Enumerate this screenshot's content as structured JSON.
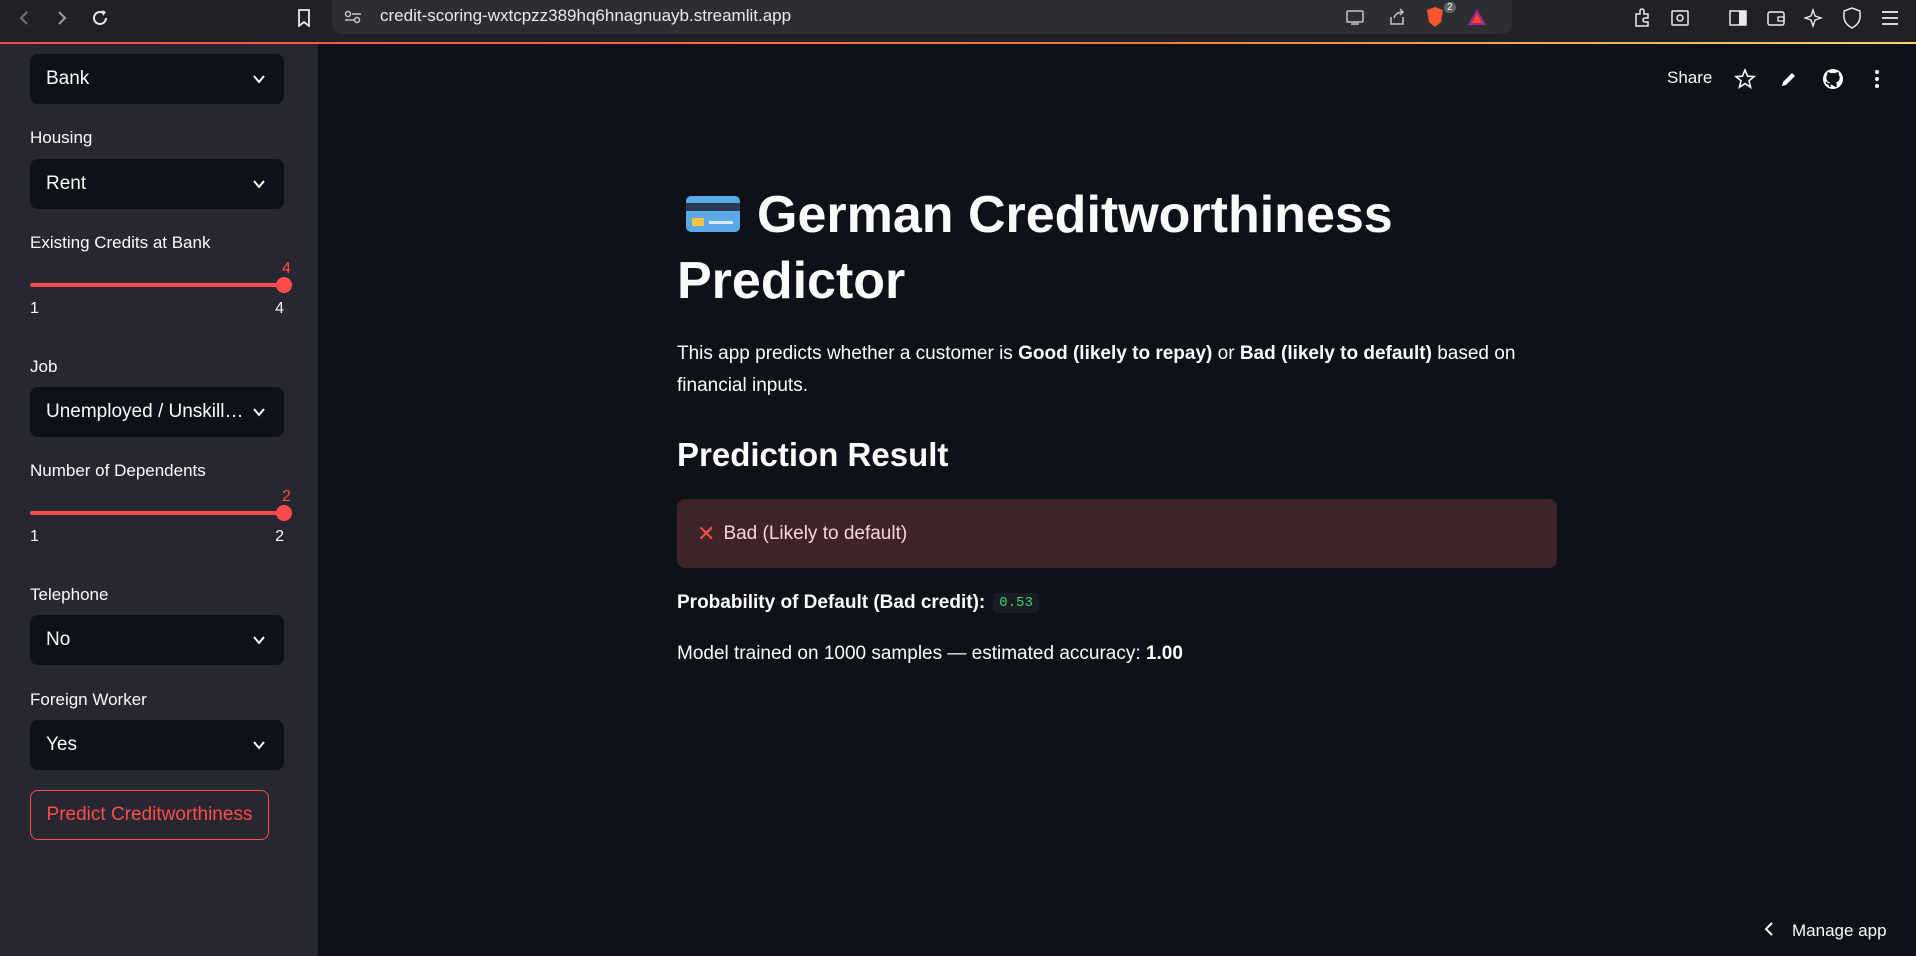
{
  "browser": {
    "url": "credit-scoring-wxtcpzz389hq6hnagnuayb.streamlit.app",
    "back_icon": "chevron-left-icon",
    "forward_icon": "chevron-right-icon",
    "reload_icon": "reload-icon",
    "brave_badge": "2"
  },
  "sidebar": {
    "purpose_select": {
      "value": "Bank"
    },
    "housing": {
      "label": "Housing",
      "value": "Rent"
    },
    "existing_credits": {
      "label": "Existing Credits at Bank",
      "current": "4",
      "min": "1",
      "max": "4",
      "fraction": 1.0
    },
    "job": {
      "label": "Job",
      "value": "Unemployed / Unskilled - Non-resident"
    },
    "dependents": {
      "label": "Number of Dependents",
      "current": "2",
      "min": "1",
      "max": "2",
      "fraction": 1.0
    },
    "telephone": {
      "label": "Telephone",
      "value": "No"
    },
    "foreign_worker": {
      "label": "Foreign Worker",
      "value": "Yes"
    },
    "predict_button": "Predict Creditworthiness"
  },
  "toolbar": {
    "share": "Share"
  },
  "main": {
    "title": "German Creditworthiness Predictor",
    "desc_pre": "This app predicts whether a customer is ",
    "desc_good": "Good (likely to repay)",
    "desc_mid": " or ",
    "desc_bad": "Bad (likely to default)",
    "desc_post": " based on financial inputs.",
    "section": "Prediction Result",
    "result": "Bad (Likely to default)",
    "prob_label": "Probability of Default (Bad credit):",
    "prob_value": "0.53",
    "model_pre": "Model trained on 1000 samples — estimated accuracy: ",
    "model_acc": "1.00"
  },
  "footer": {
    "manage_app": "Manage app"
  },
  "colors": {
    "accent": "#ff4b4b",
    "bg": "#0e1117",
    "sidebar": "#262730",
    "error_bg": "#3e2328"
  }
}
